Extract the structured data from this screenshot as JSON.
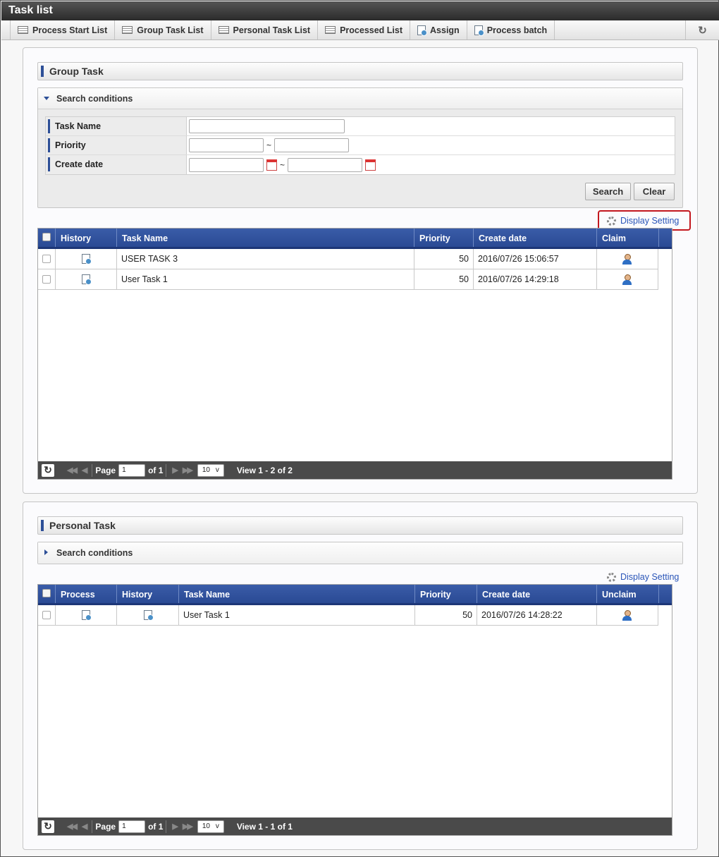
{
  "window": {
    "title": "Task list"
  },
  "toolbar": {
    "items": [
      "Process Start List",
      "Group Task List",
      "Personal Task List",
      "Processed List",
      "Assign",
      "Process batch"
    ]
  },
  "group": {
    "title": "Group Task",
    "search_title": "Search conditions",
    "fields": {
      "task_name": "Task Name",
      "priority": "Priority",
      "create_date": "Create date"
    },
    "range_sep": "~",
    "search_btn": "Search",
    "clear_btn": "Clear",
    "display_setting": "Display Setting",
    "columns": [
      "History",
      "Task Name",
      "Priority",
      "Create date",
      "Claim"
    ],
    "rows": [
      {
        "task": "USER TASK 3",
        "priority": "50",
        "date": "2016/07/26 15:06:57"
      },
      {
        "task": "User Task 1",
        "priority": "50",
        "date": "2016/07/26 14:29:18"
      }
    ],
    "pager": {
      "page_label": "Page",
      "page": "1",
      "of": "of 1",
      "size": "10",
      "view": "View 1 - 2 of 2"
    }
  },
  "personal": {
    "title": "Personal Task",
    "search_title": "Search conditions",
    "display_setting": "Display Setting",
    "columns": [
      "Process",
      "History",
      "Task Name",
      "Priority",
      "Create date",
      "Unclaim"
    ],
    "rows": [
      {
        "task": "User Task 1",
        "priority": "50",
        "date": "2016/07/26 14:28:22"
      }
    ],
    "pager": {
      "page_label": "Page",
      "page": "1",
      "of": "of 1",
      "size": "10",
      "view": "View 1 - 1 of 1"
    }
  },
  "colors": {
    "header": "#2d4f97",
    "highlight": "#c3171e",
    "link": "#2a55b8"
  }
}
